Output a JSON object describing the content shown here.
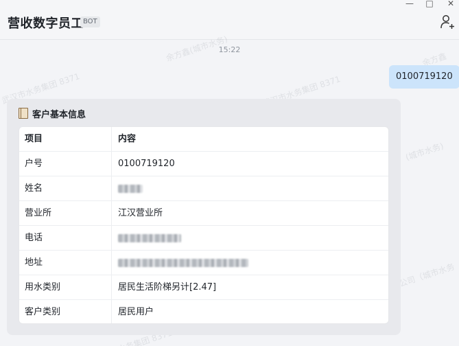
{
  "window": {
    "title": "营收数字员工",
    "badge": "BOT",
    "minimize_glyph": "—",
    "maximize_glyph": "□",
    "close_glyph": "✕",
    "add_member_icon": "add-person-icon"
  },
  "chat": {
    "timestamp": "15:22",
    "user_message": "0100719120",
    "watermarks": [
      "余方鑫(城市水务)",
      "武汉市水务集团 8371",
      "余方鑫",
      "(城市水务)",
      "公司（城市水务",
      "武汉市水务集团 8371",
      "水务集团 8371"
    ]
  },
  "card": {
    "title": "客户基本信息",
    "icon": "ledger-book-icon",
    "header": {
      "item": "项目",
      "content": "内容"
    },
    "rows": [
      {
        "item": "户号",
        "content": "0100719120",
        "redacted": false
      },
      {
        "item": "姓名",
        "content": "",
        "redacted": true
      },
      {
        "item": "营业所",
        "content": "江汉营业所",
        "redacted": false
      },
      {
        "item": "电话",
        "content": "",
        "redacted": true
      },
      {
        "item": "地址",
        "content": "",
        "redacted": true
      },
      {
        "item": "用水类别",
        "content": "居民生活阶梯另计[2.47]",
        "redacted": false
      },
      {
        "item": "客户类别",
        "content": "居民用户",
        "redacted": false
      }
    ]
  }
}
